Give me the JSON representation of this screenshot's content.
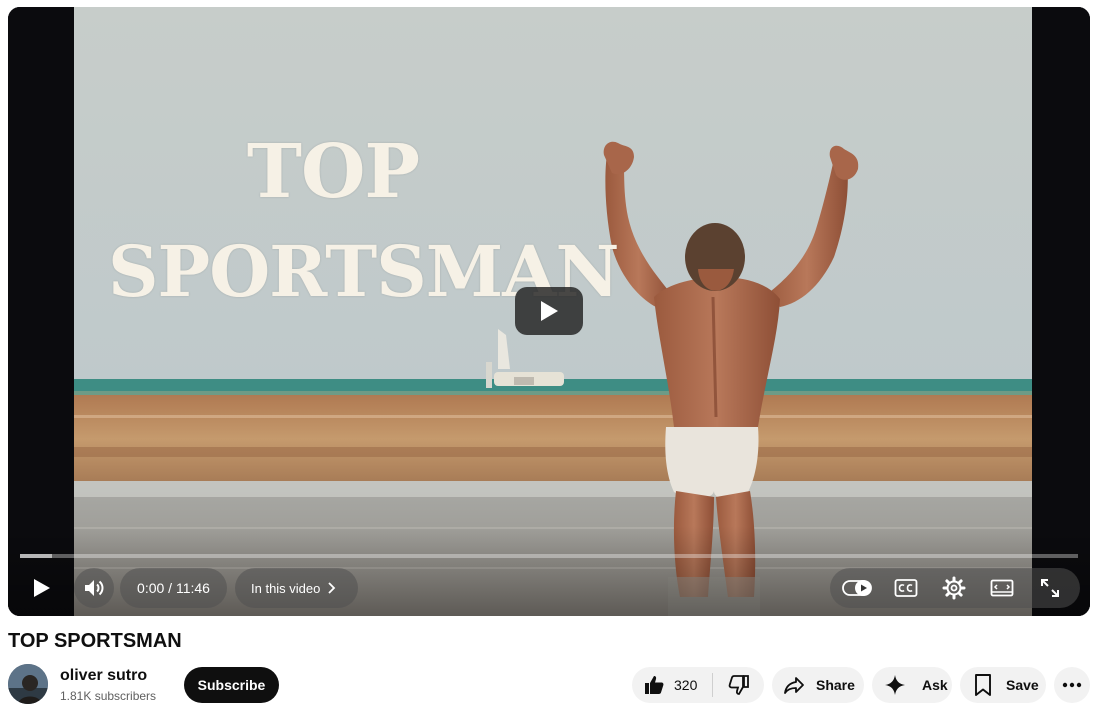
{
  "player": {
    "overlay_title_line1": "TOP",
    "overlay_title_line2": "SPORTSMAN",
    "time_display": "0:00 / 11:46",
    "in_this_video_label": "In this video",
    "progress_buffered_fraction": 0.03,
    "progress_played_fraction": 0.0
  },
  "video": {
    "title": "TOP SPORTSMAN"
  },
  "channel": {
    "name": "oliver sutro",
    "subscribers": "1.81K subscribers",
    "subscribe_label": "Subscribe"
  },
  "actions": {
    "like_count": "320",
    "share_label": "Share",
    "ask_label": "Ask",
    "save_label": "Save"
  },
  "colors": {
    "sky": "#c3cbcb",
    "sea": "#3f8f86",
    "sand": "#b98a5c",
    "subscribe_bg": "#0f0f0f",
    "chip_bg": "#f2f2f2"
  }
}
